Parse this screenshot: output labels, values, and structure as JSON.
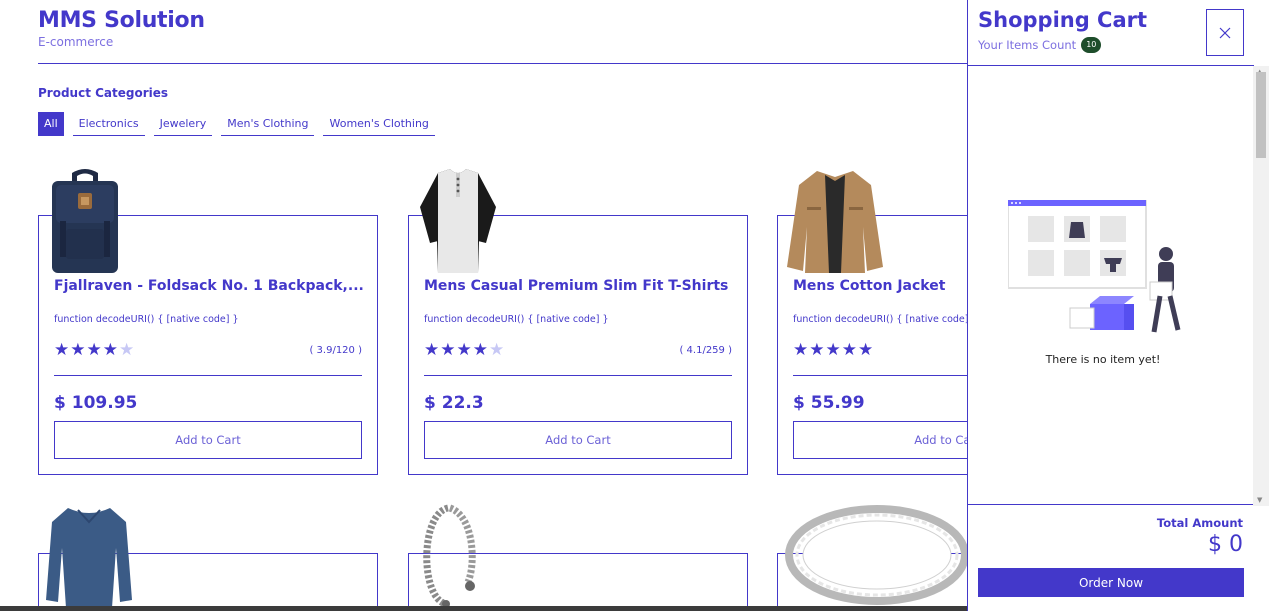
{
  "brand": {
    "title": "MMS Solution",
    "subtitle": "E-commerce"
  },
  "categories": {
    "title": "Product Categories",
    "items": [
      "All",
      "Electronics",
      "Jewelery",
      "Men's Clothing",
      "Women's Clothing"
    ],
    "active": "All"
  },
  "products": [
    {
      "title": "Fjallraven - Foldsack No. 1 Backpack,...",
      "desc": "function decodeURI() { [native code] }",
      "rating_value": 3.9,
      "rating": "( 3.9/120 )",
      "price": "$ 109.95",
      "button": "Add to Cart",
      "image_icon": "backpack-icon"
    },
    {
      "title": "Mens Casual Premium Slim Fit T-Shirts",
      "desc": "function decodeURI() { [native code] }",
      "rating_value": 4.1,
      "rating": "( 4.1/259 )",
      "price": "$ 22.3",
      "button": "Add to Cart",
      "image_icon": "tshirt-icon"
    },
    {
      "title": "Mens Cotton Jacket",
      "desc": "function decodeURI() { [native code] }",
      "rating_value": 4.7,
      "rating": "",
      "price": "$ 55.99",
      "button": "Add to Cart",
      "image_icon": "jacket-icon"
    }
  ],
  "cart": {
    "title": "Shopping Cart",
    "count_label": "Your Items Count",
    "count": "10",
    "close_icon": "close-icon",
    "empty_text": "There is no item yet!",
    "total_label": "Total Amount",
    "total_value": "$ 0",
    "order_button": "Order Now"
  },
  "colors": {
    "accent": "#4338ca",
    "badge": "#1e4d2b"
  }
}
